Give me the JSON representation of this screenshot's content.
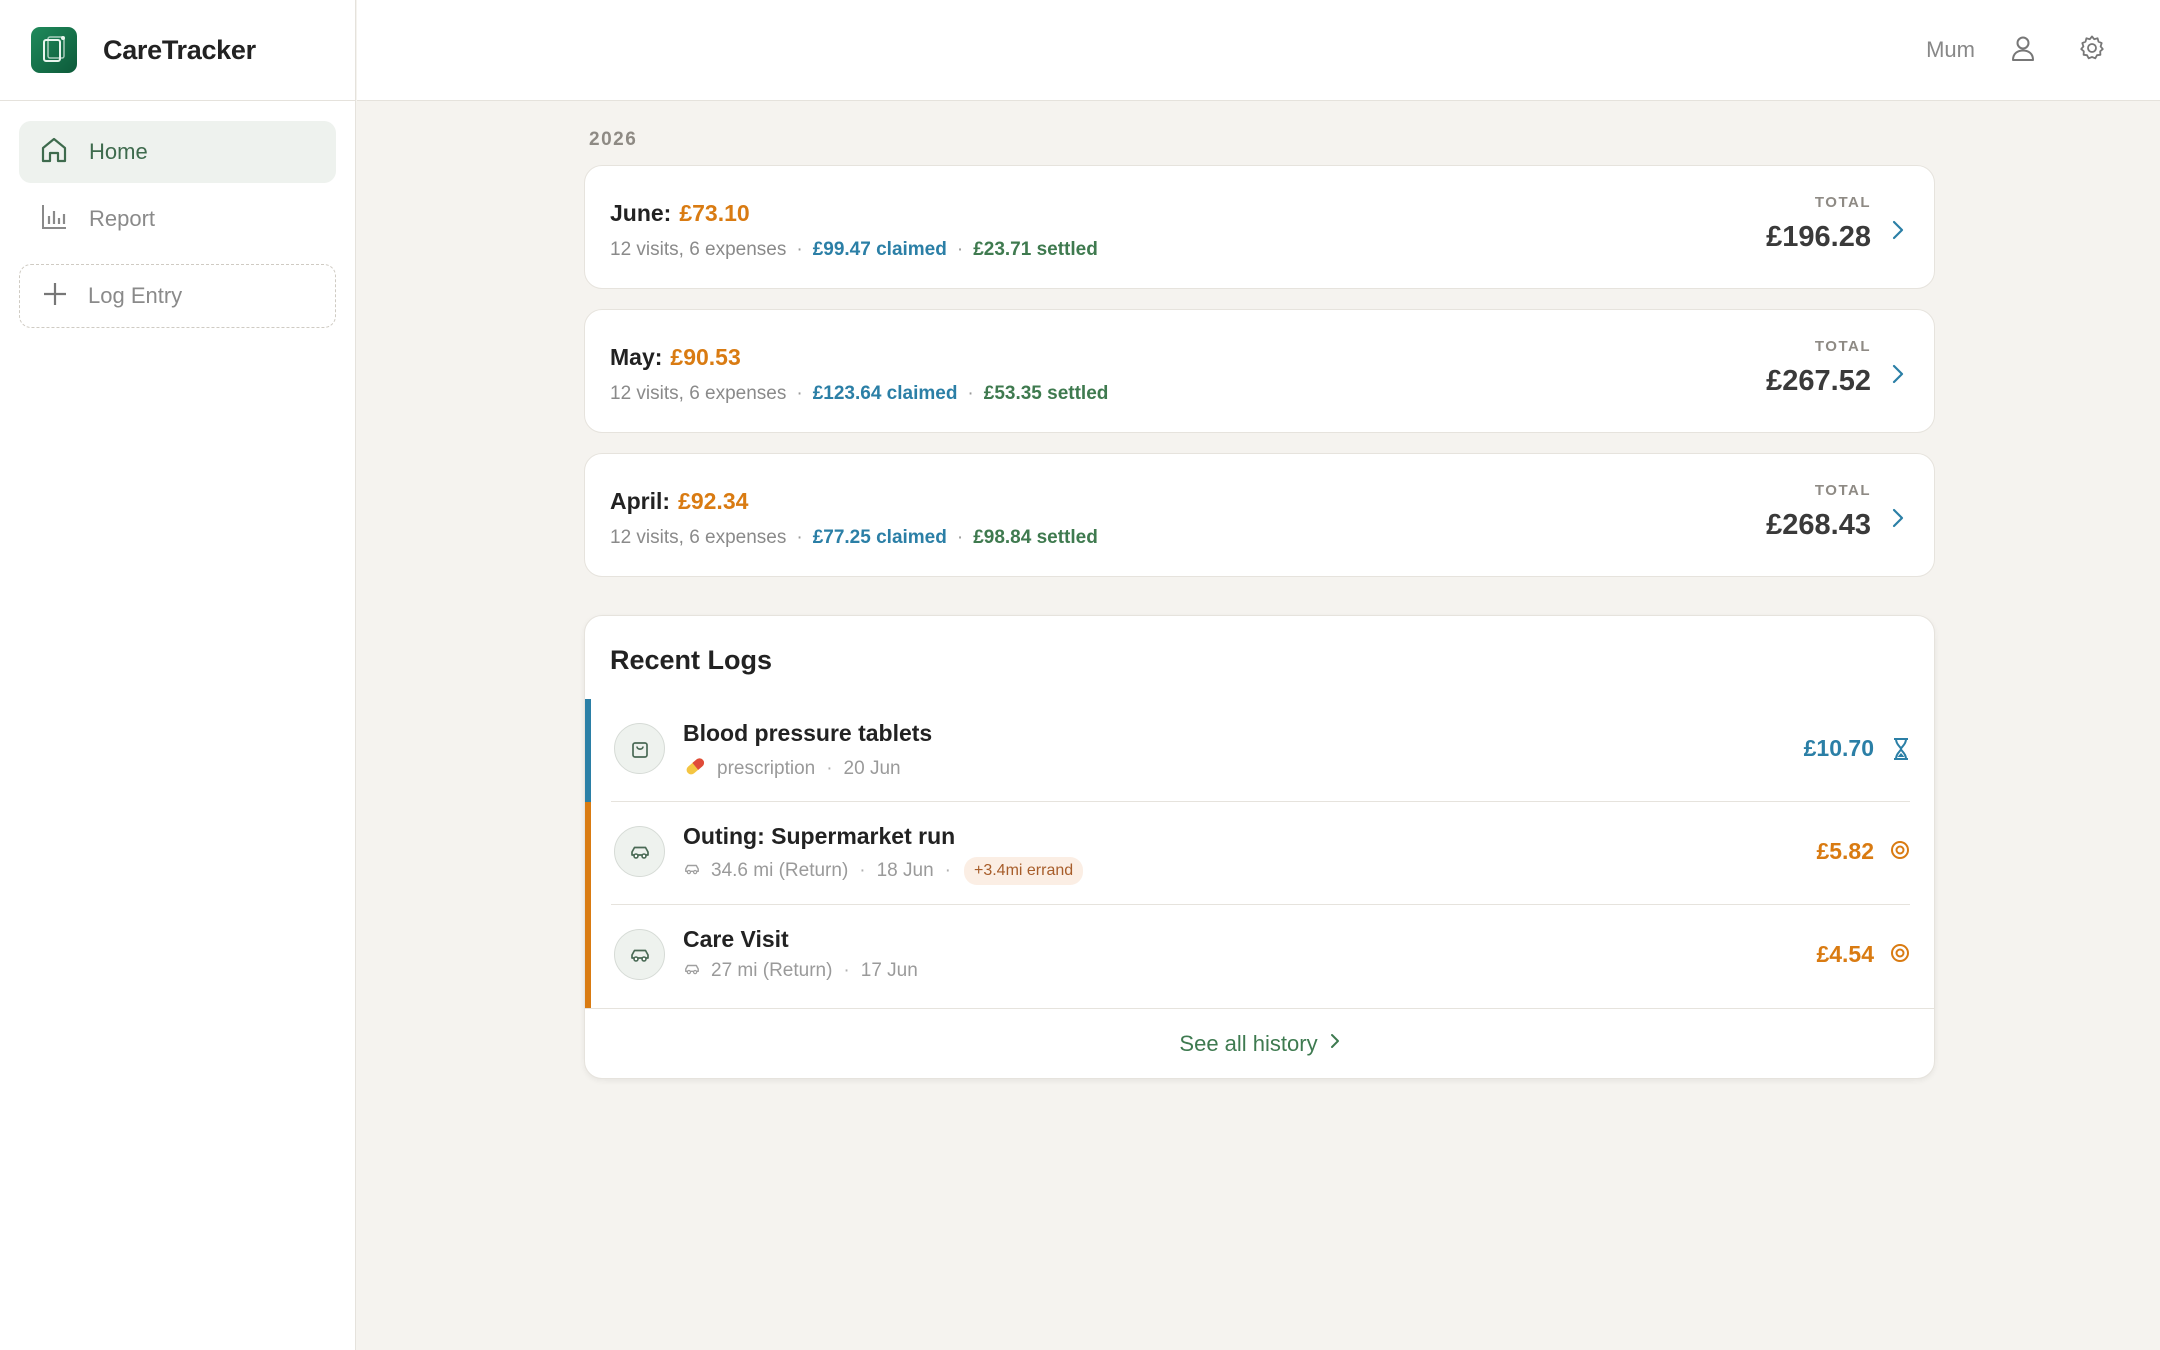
{
  "app": {
    "name": "CareTracker"
  },
  "nav": {
    "home": "Home",
    "report": "Report",
    "log_entry": "Log Entry"
  },
  "header": {
    "profile_name": "Mum"
  },
  "year_label": "2026",
  "total_label": "TOTAL",
  "months": [
    {
      "name": "June:",
      "amount": "£73.10",
      "summary": "12 visits, 6 expenses",
      "claimed": "£99.47 claimed",
      "settled": "£23.71 settled",
      "total": "£196.28"
    },
    {
      "name": "May:",
      "amount": "£90.53",
      "summary": "12 visits, 6 expenses",
      "claimed": "£123.64 claimed",
      "settled": "£53.35 settled",
      "total": "£267.52"
    },
    {
      "name": "April:",
      "amount": "£92.34",
      "summary": "12 visits, 6 expenses",
      "claimed": "£77.25 claimed",
      "settled": "£98.84 settled",
      "total": "£268.43"
    }
  ],
  "recent": {
    "title": "Recent Logs",
    "items": [
      {
        "title": "Blood pressure tablets",
        "meta_icon": "pill-emoji",
        "category": "prescription",
        "date": "20 Jun",
        "amount": "£10.70",
        "status": "hourglass-icon"
      },
      {
        "title": "Outing: Supermarket run",
        "meta_icon": "car-icon",
        "distance": "34.6 mi (Return)",
        "date": "18 Jun",
        "tag": "+3.4mi errand",
        "amount": "£5.82",
        "status": "target-icon"
      },
      {
        "title": "Care Visit",
        "meta_icon": "car-icon",
        "distance": "27 mi (Return)",
        "date": "17 Jun",
        "amount": "£4.54",
        "status": "target-icon"
      }
    ],
    "see_all": "See all history"
  },
  "colors": {
    "accent_green": "#3e6b4d",
    "claimed_blue": "#2b7fa6",
    "pending_orange": "#d97b12",
    "settled_green": "#3f7a4f",
    "background": "#f5f3ef"
  }
}
